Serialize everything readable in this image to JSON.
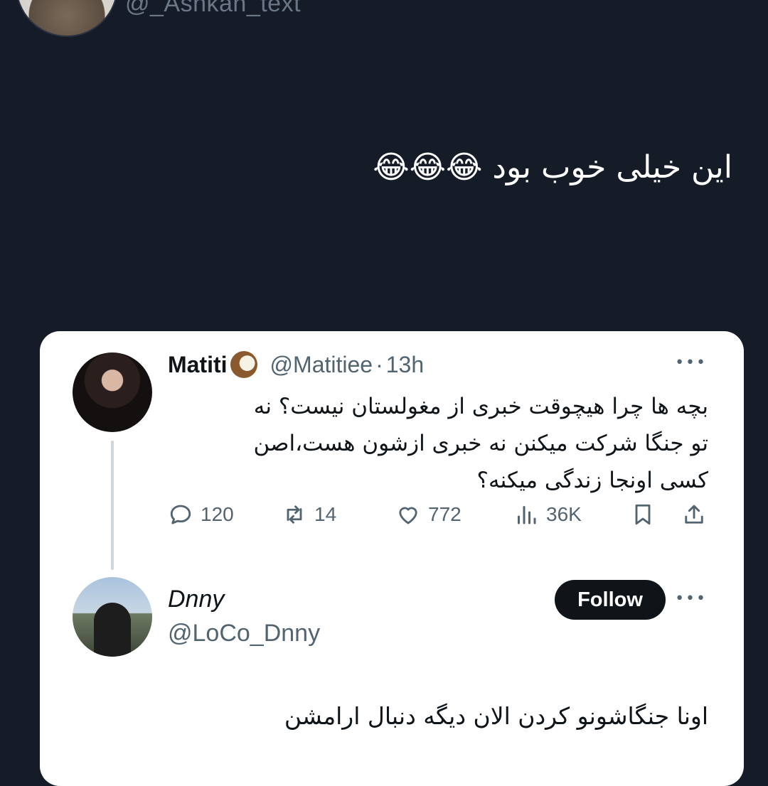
{
  "header": {
    "handle": "@_Ashkan_text"
  },
  "caption": {
    "text": "این خیلی خوب بود 😂😂😂"
  },
  "quoted_post": {
    "name": "Matiti",
    "handle": "@Matitiee",
    "separator": "·",
    "time": "13h",
    "text_lines": [
      "بچه ها چرا هیچوقت خبری از مغولستان نیست؟ نه",
      "تو جنگا شرکت میکنن نه خبری ازشون هست،اصن",
      "کسی اونجا زندگی میکنه؟"
    ],
    "actions": {
      "replies": "120",
      "retweets": "14",
      "likes": "772",
      "views": "36K"
    }
  },
  "reply": {
    "name": "Dnny",
    "handle": "@LoCo_Dnny",
    "follow_label": "Follow",
    "text": "اونا جنگاشونو کردن الان دیگه دنبال ارامشن"
  },
  "colors": {
    "background": "#151c28",
    "card": "#ffffff",
    "text_primary": "#0f1419",
    "text_secondary": "#536471"
  },
  "icons": [
    "coconut-icon",
    "more-icon",
    "reply-icon",
    "retweet-icon",
    "like-icon",
    "views-icon",
    "bookmark-icon",
    "share-icon"
  ]
}
